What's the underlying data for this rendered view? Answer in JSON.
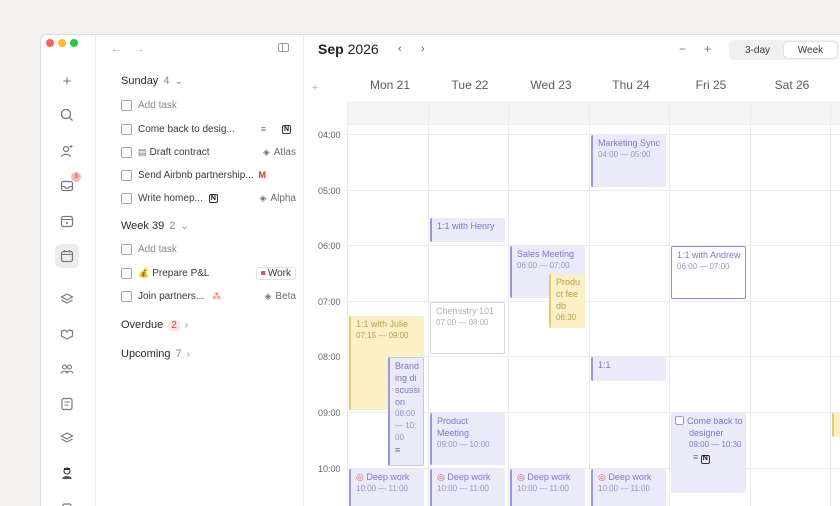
{
  "rail": {
    "inbox_badge": "3"
  },
  "sidebar": {
    "sunday": {
      "label": "Sunday",
      "count": "4"
    },
    "sunday_tasks": [
      {
        "title": "Add task"
      },
      {
        "title": "Come back to desig..."
      },
      {
        "title": "Draft contract",
        "project": "Atlas"
      },
      {
        "title": "Send Airbnb partnership..."
      },
      {
        "title": "Write homep...",
        "project": "Alpha"
      }
    ],
    "week39": {
      "label": "Week 39",
      "count": "2"
    },
    "week_tasks": [
      {
        "title": "Add task"
      },
      {
        "title": "Prepare P&L",
        "tag": "Work"
      },
      {
        "title": "Join partners...",
        "project": "Beta"
      }
    ],
    "overdue": {
      "label": "Overdue",
      "count": "2"
    },
    "upcoming": {
      "label": "Upcoming",
      "count": "7"
    }
  },
  "calendar": {
    "month": "Sep",
    "year": "2026",
    "views": {
      "three_day": "3-day",
      "week": "Week"
    },
    "days": [
      {
        "name": "Mon",
        "num": "21"
      },
      {
        "name": "Tue",
        "num": "22"
      },
      {
        "name": "Wed",
        "num": "23"
      },
      {
        "name": "Thu",
        "num": "24"
      },
      {
        "name": "Fri",
        "num": "25"
      },
      {
        "name": "Sat",
        "num": "26"
      }
    ],
    "hours": [
      "04:00",
      "05:00",
      "06:00",
      "07:00",
      "08:00",
      "09:00",
      "10:00"
    ],
    "events": {
      "marketing": {
        "title": "Marketing Sync",
        "time": "04:00 — 05:00"
      },
      "henry": {
        "title": "1:1 with Henry"
      },
      "sales": {
        "title": "Sales Meeting",
        "time": "06:00 — 07:00"
      },
      "product_feedback": {
        "title": "Product feedb",
        "time": "06:30"
      },
      "andrew": {
        "title": "1:1 with Andrew",
        "time": "06:00 — 07:00"
      },
      "chemistry": {
        "title": "Chemistry 101",
        "time": "07:00 — 08:00"
      },
      "julie": {
        "title": "1:1 with Julie",
        "time": "07:15 — 09:00"
      },
      "branding": {
        "title": "Branding discussion",
        "time": "08:00 — 10:00"
      },
      "one_on_one": {
        "title": "1:1"
      },
      "product_meeting": {
        "title": "Product Meeting",
        "time": "09:00 — 10:00"
      },
      "come_back": {
        "title": "Come back to designer",
        "time": "09:00 — 10:30"
      },
      "deep_work": {
        "title": "Deep work",
        "time": "10:00 — 11:00"
      }
    }
  }
}
